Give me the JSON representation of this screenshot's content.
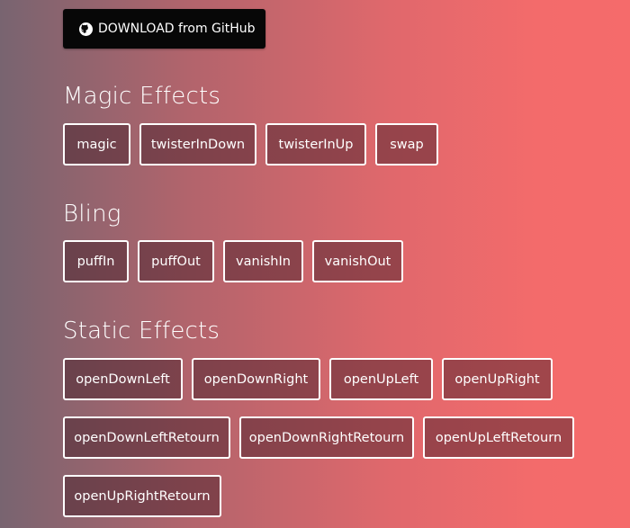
{
  "download": {
    "label": "DOWNLOAD from GitHub",
    "icon": "github-icon"
  },
  "sections": [
    {
      "title": "Magic Effects",
      "rows": [
        [
          "magic",
          "twisterInDown",
          "twisterInUp",
          "swap"
        ]
      ]
    },
    {
      "title": "Bling",
      "rows": [
        [
          "puffIn",
          "puffOut",
          "vanishIn",
          "vanishOut"
        ]
      ]
    },
    {
      "title": "Static Effects",
      "rows": [
        [
          "openDownLeft",
          "openDownRight",
          "openUpLeft",
          "openUpRight"
        ],
        [
          "openDownLeftRetourn",
          "openDownRightRetourn",
          "openUpLeftRetourn"
        ],
        [
          "openUpRightRetourn"
        ]
      ]
    }
  ],
  "colors": {
    "download_bg": "#070707",
    "button_border": "#ffffff",
    "gradient_start": "#786470",
    "gradient_end": "#f56b6b"
  }
}
